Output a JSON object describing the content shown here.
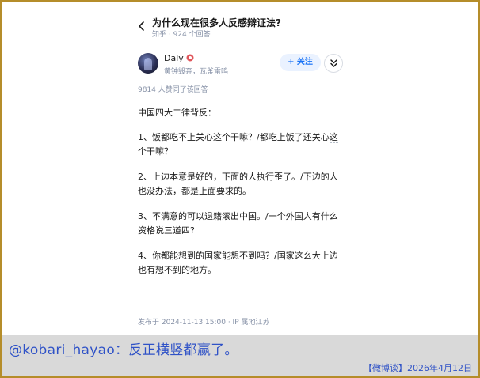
{
  "question": {
    "title": "为什么现在很多人反感辩证法?",
    "meta": "知乎 · 924 个回答"
  },
  "author": {
    "name": "Daly",
    "bio": "黄钟毁弃，瓦釜雷鸣",
    "avatar_icon": "avatar-dark-figure",
    "badge_icon": "red-badge-icon",
    "follow_label": "+ 关注",
    "expand_icon": "double-chevron-down-icon"
  },
  "answer": {
    "upvotes": "9814 人赞同了该回答",
    "intro": "中国四大二律背反：",
    "items": [
      {
        "before": "1、饭都吃不上关心这个干嘛？/都吃上饭了还关心",
        "underlined": "这个干嘛？"
      },
      {
        "before": "2、上边本意是好的，下面的人执行歪了。/下边的人也没办法，都是上面要求的。",
        "underlined": ""
      },
      {
        "before": "3、不满意的可以退籍滚出中国。/一个外国人有什么资格说三道四?",
        "underlined": ""
      },
      {
        "before": "4、你都能想到的国家能想不到吗？/国家这么大上边也有想不到的地方。",
        "underlined": ""
      }
    ],
    "post_meta": "发布于 2024-11-13 15:00 · IP 属地江苏"
  },
  "caption": {
    "text": "@kobari_hayao：反正横竖都赢了。",
    "source": "【微博谈】2026年4月12日"
  },
  "colors": {
    "frame": "#b58d2a",
    "caption_bg": "#d9d9d9",
    "caption_text": "#2f52c7",
    "link_blue": "#1772f6"
  }
}
